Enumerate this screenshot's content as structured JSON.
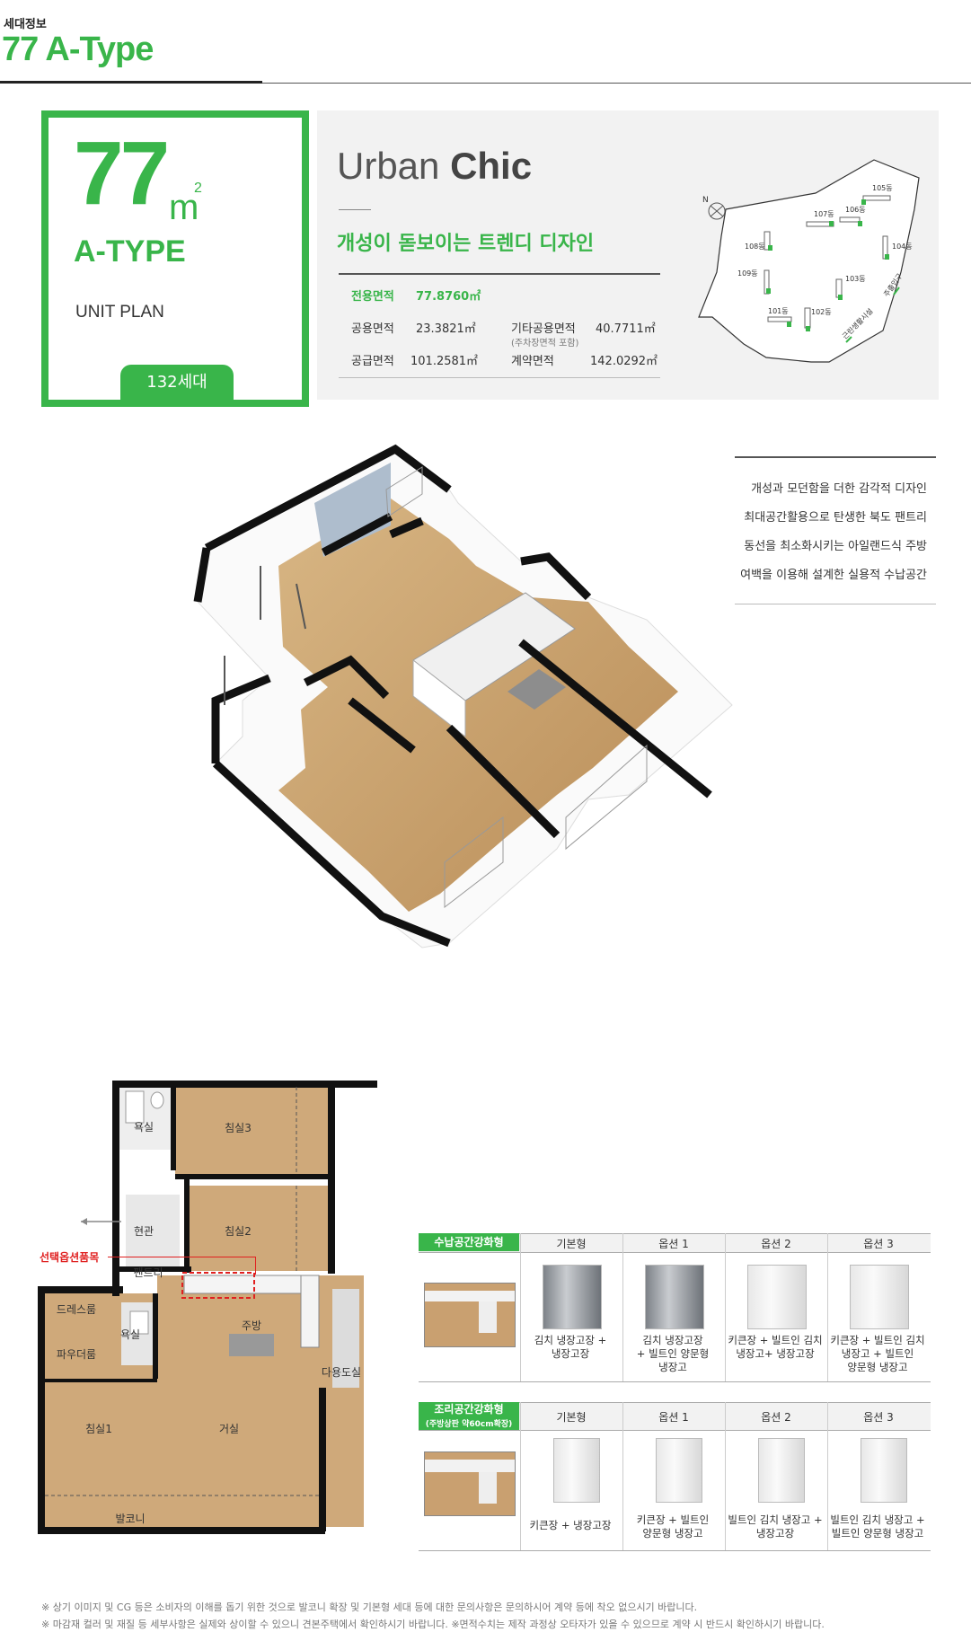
{
  "header": {
    "label": "세대정보",
    "title": "77 A-Type"
  },
  "unit_box": {
    "number": "77",
    "unit": "m",
    "sup": "2",
    "type": "A-TYPE",
    "plan": "UNIT PLAN",
    "households": "132세대"
  },
  "info": {
    "heading_light": "Urban ",
    "heading_bold": "Chic",
    "slogan": "개성이 돋보이는 트렌디 디자인",
    "rows": {
      "exclusive_label": "전용면적",
      "exclusive_value": "77.8760㎡",
      "common_label": "공용면적",
      "common_value": "23.3821㎡",
      "other_label": "기타공용면적",
      "other_sub": "(주차장면적 포함)",
      "other_value": "40.7711㎡",
      "supply_label": "공급면적",
      "supply_value": "101.2581㎡",
      "contract_label": "계약면적",
      "contract_value": "142.0292㎡"
    }
  },
  "sitemap": {
    "buildings": [
      "105동",
      "107동",
      "106동",
      "108동",
      "104동",
      "109동",
      "103동",
      "101동",
      "102동"
    ],
    "entrance1": "주출입구",
    "entrance2": "근린생활시설"
  },
  "features": [
    "개성과 모던함을 더한 감각적 디자인",
    "최대공간활용으로 탄생한 북도 팬트리",
    "동선을 최소화시키는 아일랜드식 주방",
    "여백을 이용해 설계한 실용적 수납공간"
  ],
  "floorplan": {
    "rooms": [
      "욕실",
      "침실3",
      "현관",
      "침실2",
      "팬트리",
      "드레스룸",
      "욕실",
      "주방",
      "파우더룸",
      "다용도실",
      "침실1",
      "거실",
      "발코니"
    ],
    "callout": "선택옵션품목"
  },
  "options_storage": {
    "tag": "수납공간강화형",
    "columns": [
      "기본형",
      "옵션 1",
      "옵션 2",
      "옵션 3"
    ],
    "captions": [
      "김치 냉장고장 +\n냉장고장",
      "김치 냉장고장\n+ 빌트인 양문형\n냉장고",
      "키큰장 + 빌트인 김치\n냉장고+ 냉장고장",
      "키큰장 + 빌트인 김치\n냉장고 + 빌트인\n양문형 냉장고"
    ]
  },
  "options_cooking": {
    "tag": "조리공간강화형",
    "tag_sub": "(주방상판 약60cm확장)",
    "columns": [
      "기본형",
      "옵션 1",
      "옵션 2",
      "옵션 3"
    ],
    "captions": [
      "키큰장 + 냉장고장",
      "키큰장 + 빌트인\n양문형 냉장고",
      "빌트인 김치 냉장고 +\n냉장고장",
      "빌트인 김치 냉장고 +\n빌트인 양문형 냉장고"
    ]
  },
  "notes": [
    "※ 상기 이미지 및 CG 등은 소비자의 이해를 돕기 위한 것으로 발코니 확장 및 기본형 세대 등에 대한 문의사항은 문의하시어 계약 등에 착오 없으시기 바랍니다.",
    "※ 마감재 컬러 및 재질 등 세부사항은 실제와 상이할 수 있으니 견본주택에서 확인하시기 바랍니다. ※면적수치는 제작 과정상 오타자가 있을 수 있으므로 계약 시 반드시 확인하시기 바랍니다."
  ],
  "colors": {
    "accent": "#39b54a",
    "panel": "#f2f2f2",
    "floor": "#c8a36e",
    "wall": "#111111"
  }
}
